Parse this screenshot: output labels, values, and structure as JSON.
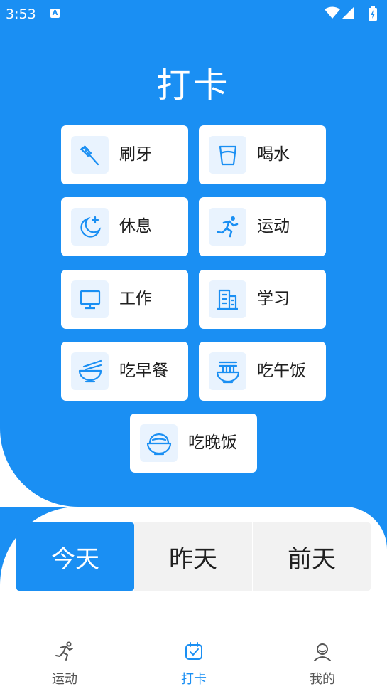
{
  "status_bar": {
    "time": "3:53",
    "notification_icon": "A"
  },
  "title": "打卡",
  "checkin_items": [
    {
      "label": "刷牙",
      "icon": "toothbrush-icon"
    },
    {
      "label": "喝水",
      "icon": "water-cup-icon"
    },
    {
      "label": "休息",
      "icon": "moon-icon"
    },
    {
      "label": "运动",
      "icon": "running-icon"
    },
    {
      "label": "工作",
      "icon": "monitor-icon"
    },
    {
      "label": "学习",
      "icon": "building-icon"
    },
    {
      "label": "吃早餐",
      "icon": "bowl-chopsticks-icon"
    },
    {
      "label": "吃午饭",
      "icon": "noodle-bowl-icon"
    },
    {
      "label": "吃晚饭",
      "icon": "rice-bowl-icon"
    }
  ],
  "day_tabs": [
    {
      "label": "今天",
      "active": true
    },
    {
      "label": "昨天",
      "active": false
    },
    {
      "label": "前天",
      "active": false
    }
  ],
  "bottom_nav": [
    {
      "label": "运动",
      "icon": "running-icon",
      "active": false
    },
    {
      "label": "打卡",
      "icon": "calendar-check-icon",
      "active": true
    },
    {
      "label": "我的",
      "icon": "user-icon",
      "active": false
    }
  ],
  "colors": {
    "primary": "#1a8ff3",
    "icon_bg": "#e9f3fe",
    "tab_bg": "#f2f2f2"
  }
}
